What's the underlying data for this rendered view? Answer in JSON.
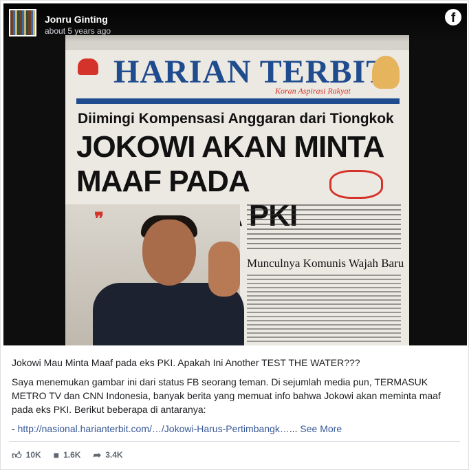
{
  "post": {
    "author": "Jonru Ginting",
    "timestamp": "about 5 years ago",
    "platform_icon": "facebook-icon"
  },
  "newspaper": {
    "masthead": "HARIAN TERBIT",
    "tagline": "Koran Aspirasi Rakyat",
    "subhead": "Diimingi Kompensasi Anggaran dari Tiongkok",
    "headline": "JOKOWI AKAN MINTA MAAF PADA KELUARGA PKI",
    "article_subtitle": "Munculnya Komunis Wajah Baru"
  },
  "caption": {
    "line1": "Jokowi Mau Minta Maaf pada eks PKI. Apakah Ini Another TEST THE WATER???",
    "line2": "Saya menemukan gambar ini dari status FB seorang teman. Di sejumlah media pun, TERMASUK METRO TV dan CNN Indonesia, banyak berita yang memuat info bahwa Jokowi akan meminta maaf pada eks PKI. Berikut beberapa di antaranya:",
    "link_prefix": "- ",
    "link": "http://nasional.harianterbit.com/…/Jokowi-Harus-Pertimbangk…",
    "ellipsis": "... ",
    "see_more": "See More"
  },
  "stats": {
    "likes": "10K",
    "comments": "1.6K",
    "shares": "3.4K"
  },
  "colors": {
    "link": "#385898",
    "masthead_blue": "#1f4b8f",
    "accent_red": "#d4332b"
  }
}
